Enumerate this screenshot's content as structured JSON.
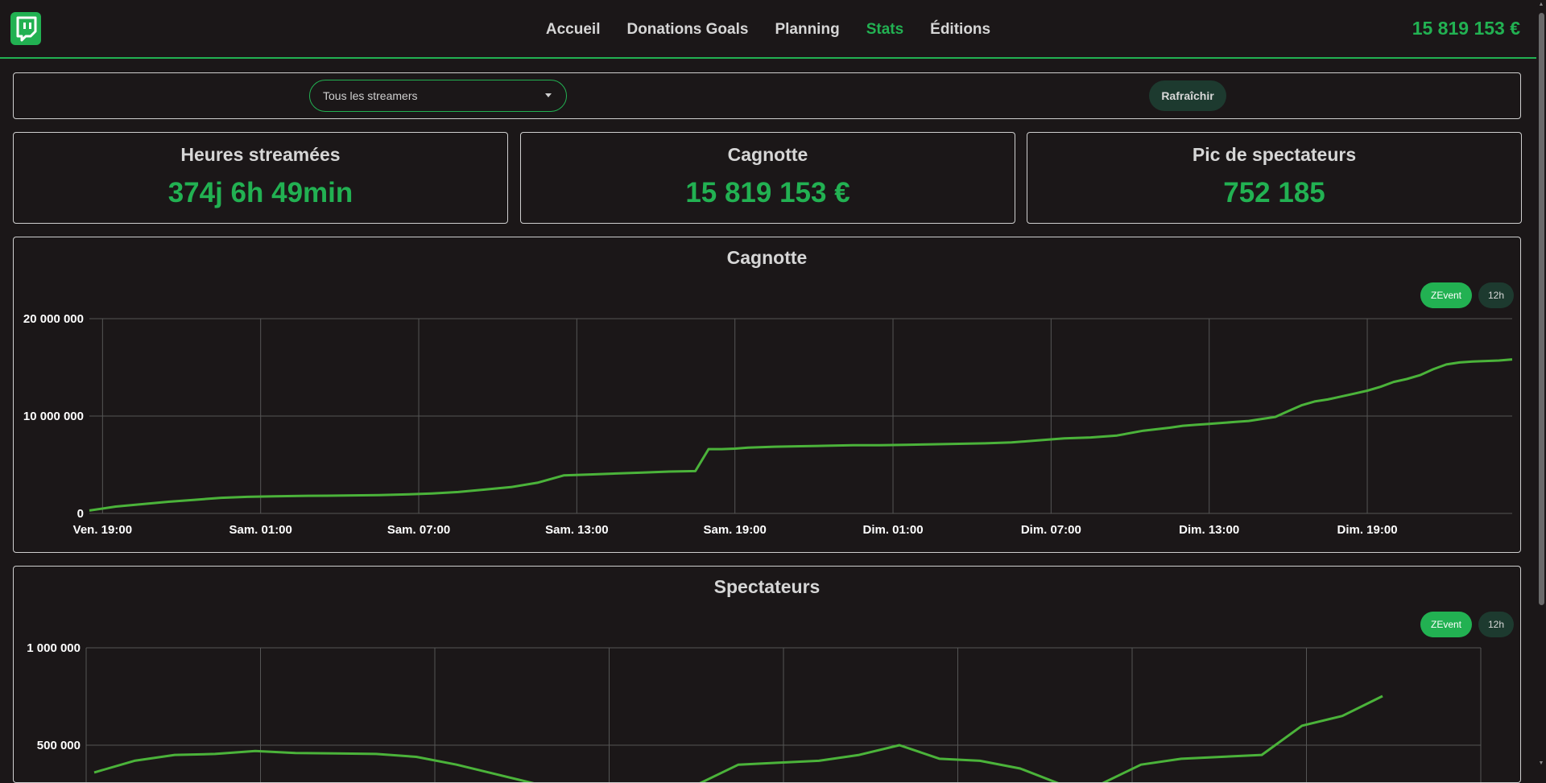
{
  "header": {
    "nav": [
      {
        "label": "Accueil",
        "active": false
      },
      {
        "label": "Donations Goals",
        "active": false
      },
      {
        "label": "Planning",
        "active": false
      },
      {
        "label": "Stats",
        "active": true
      },
      {
        "label": "Éditions",
        "active": false
      }
    ],
    "total": "15 819 153 €",
    "logo_icon": "twitch-logo-icon"
  },
  "filters": {
    "streamer_select": "Tous les streamers",
    "refresh_label": "Rafraîchir"
  },
  "stats": [
    {
      "label": "Heures streamées",
      "value": "374j 6h 49min"
    },
    {
      "label": "Cagnotte",
      "value": "15 819 153 €"
    },
    {
      "label": "Pic de spectateurs",
      "value": "752 185"
    }
  ],
  "colors": {
    "accent": "#22b152",
    "background": "#1b1718",
    "line": "#4bb33a",
    "toggle_off": "#1d3a2f"
  },
  "chart_data": [
    {
      "type": "line",
      "title": "Cagnotte",
      "toggles": [
        {
          "label": "ZEvent",
          "active": true
        },
        {
          "label": "12h",
          "active": false
        }
      ],
      "y_ticks": [
        "20 000 000",
        "10 000 000",
        "0"
      ],
      "ylim": [
        0,
        20000000
      ],
      "x_ticks": [
        "Ven. 19:00",
        "Sam. 01:00",
        "Sam. 07:00",
        "Sam. 13:00",
        "Sam. 19:00",
        "Dim. 01:00",
        "Dim. 07:00",
        "Dim. 13:00",
        "Dim. 19:00"
      ],
      "x_hours_range": [
        -0.5,
        53.5
      ],
      "grid": true,
      "series": [
        {
          "x": [
            -0.5,
            0.5,
            1.5,
            2.5,
            3.5,
            4.5,
            5.5,
            6.5,
            7.5,
            8.5,
            9.5,
            10.5,
            11.5,
            12.5,
            13.5,
            14.5,
            15.5,
            16.5,
            17.5,
            18.5,
            19.5,
            20.5,
            21.5,
            22.5,
            23.0,
            23.5,
            24.0,
            24.5,
            25.5,
            26.5,
            27.5,
            28.5,
            29.5,
            30.5,
            31.5,
            32.5,
            33.5,
            34.5,
            35.5,
            36.5,
            37.5,
            38.5,
            39.5,
            40.5,
            41.0,
            41.5,
            42.0,
            42.5,
            43.0,
            43.5,
            44.0,
            44.5,
            45.0,
            45.5,
            46.0,
            46.5,
            47.0,
            47.5,
            48.0,
            48.5,
            49.0,
            49.5,
            50.0,
            50.5,
            51.0,
            51.5,
            52.0,
            52.5,
            53.0,
            53.5
          ],
          "y": [
            300000,
            700000,
            950000,
            1200000,
            1400000,
            1600000,
            1700000,
            1750000,
            1800000,
            1820000,
            1850000,
            1880000,
            1950000,
            2050000,
            2200000,
            2450000,
            2700000,
            3150000,
            3900000,
            4000000,
            4100000,
            4200000,
            4300000,
            4350000,
            6600000,
            6600000,
            6650000,
            6750000,
            6850000,
            6900000,
            6950000,
            7000000,
            7000000,
            7050000,
            7100000,
            7150000,
            7200000,
            7300000,
            7500000,
            7700000,
            7800000,
            8000000,
            8500000,
            8800000,
            9000000,
            9100000,
            9200000,
            9300000,
            9400000,
            9500000,
            9700000,
            9900000,
            10500000,
            11100000,
            11500000,
            11700000,
            12000000,
            12300000,
            12600000,
            13000000,
            13500000,
            13800000,
            14200000,
            14800000,
            15300000,
            15500000,
            15600000,
            15650000,
            15700000,
            15819153
          ]
        }
      ]
    },
    {
      "type": "line",
      "title": "Spectateurs",
      "toggles": [
        {
          "label": "ZEvent",
          "active": true
        },
        {
          "label": "12h",
          "active": false
        }
      ],
      "y_ticks": [
        "1 000 000",
        "500 000"
      ],
      "ylim": [
        0,
        1000000
      ],
      "grid": true,
      "series": [
        {
          "x": [
            0,
            0.25,
            0.5,
            0.75,
            1.0,
            1.25,
            1.5,
            1.75,
            2.0,
            2.25,
            2.5,
            2.75,
            3.0,
            3.25,
            3.5,
            3.75,
            4.0,
            4.25,
            4.5,
            4.75,
            5.0,
            5.25,
            5.5,
            5.75,
            6.0,
            6.25,
            6.5,
            6.75,
            7.0,
            7.25,
            7.5,
            7.75,
            8.0
          ],
          "y": [
            360000,
            420000,
            450000,
            455000,
            470000,
            460000,
            458000,
            455000,
            440000,
            400000,
            350000,
            300000,
            300000,
            300000,
            300000,
            300000,
            400000,
            410000,
            420000,
            450000,
            500000,
            430000,
            420000,
            380000,
            300000,
            300000,
            400000,
            430000,
            440000,
            450000,
            600000,
            650000,
            752185
          ]
        }
      ]
    }
  ]
}
